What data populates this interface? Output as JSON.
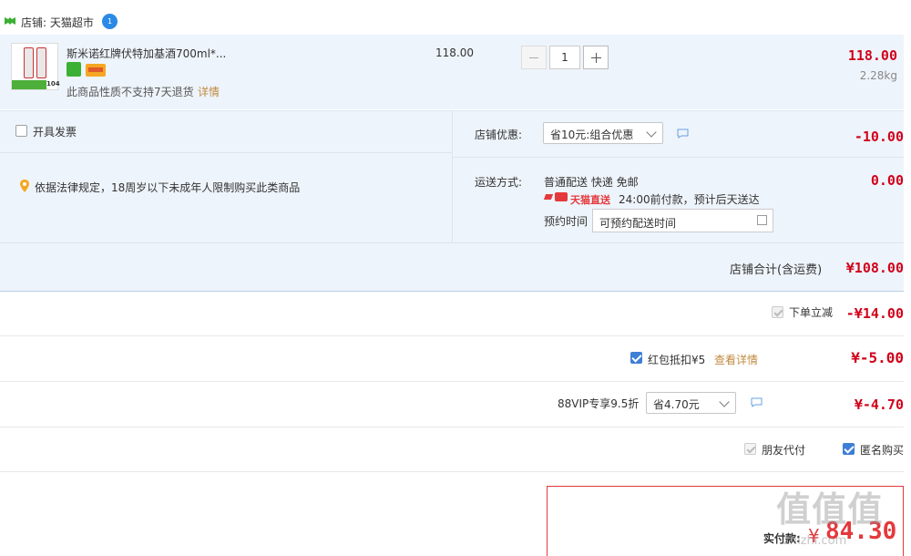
{
  "shop": {
    "label": "店铺: 天猫超市",
    "badge": "1"
  },
  "item": {
    "title": "斯米诺红牌伏特加基酒700ml*...",
    "unit_price": "118.00",
    "qty": "1",
    "total": "118.00",
    "weight": "2.28kg",
    "return_note": "此商品性质不支持7天退货",
    "detail_link": "详情",
    "thumb_tag": "104"
  },
  "invoice": {
    "label": "开具发票"
  },
  "legal": {
    "text": "依据法律规定，18周岁以下未成年人限制购买此类商品"
  },
  "discount": {
    "label": "店铺优惠:",
    "option": "省10元:组合优惠",
    "amount": "-10.00"
  },
  "shipping": {
    "label": "运送方式:",
    "method": "普通配送 快递 免邮",
    "tmall_tag": "天猫直送",
    "eta": "24:00前付款，预计后天送达",
    "appt_label": "预约时间",
    "appt_value": "可预约配送时间",
    "amount": "0.00"
  },
  "shop_total": {
    "label": "店铺合计(含运费)",
    "amount": "¥108.00"
  },
  "instant_off": {
    "label": "下单立减",
    "amount": "-¥14.00"
  },
  "red_packet": {
    "label": "红包抵扣¥5",
    "link": "查看详情",
    "amount": "¥-5.00"
  },
  "vip": {
    "label": "88VIP专享9.5折",
    "option": "省4.70元",
    "amount": "¥-4.70"
  },
  "options": {
    "friend_pay": "朋友代付",
    "anonymous": "匿名购买"
  },
  "pay": {
    "label": "实付款:",
    "amount": "84.30",
    "currency": "¥"
  },
  "watermark": {
    "text": "值 值 值",
    "sub": "zhizhi.com"
  }
}
